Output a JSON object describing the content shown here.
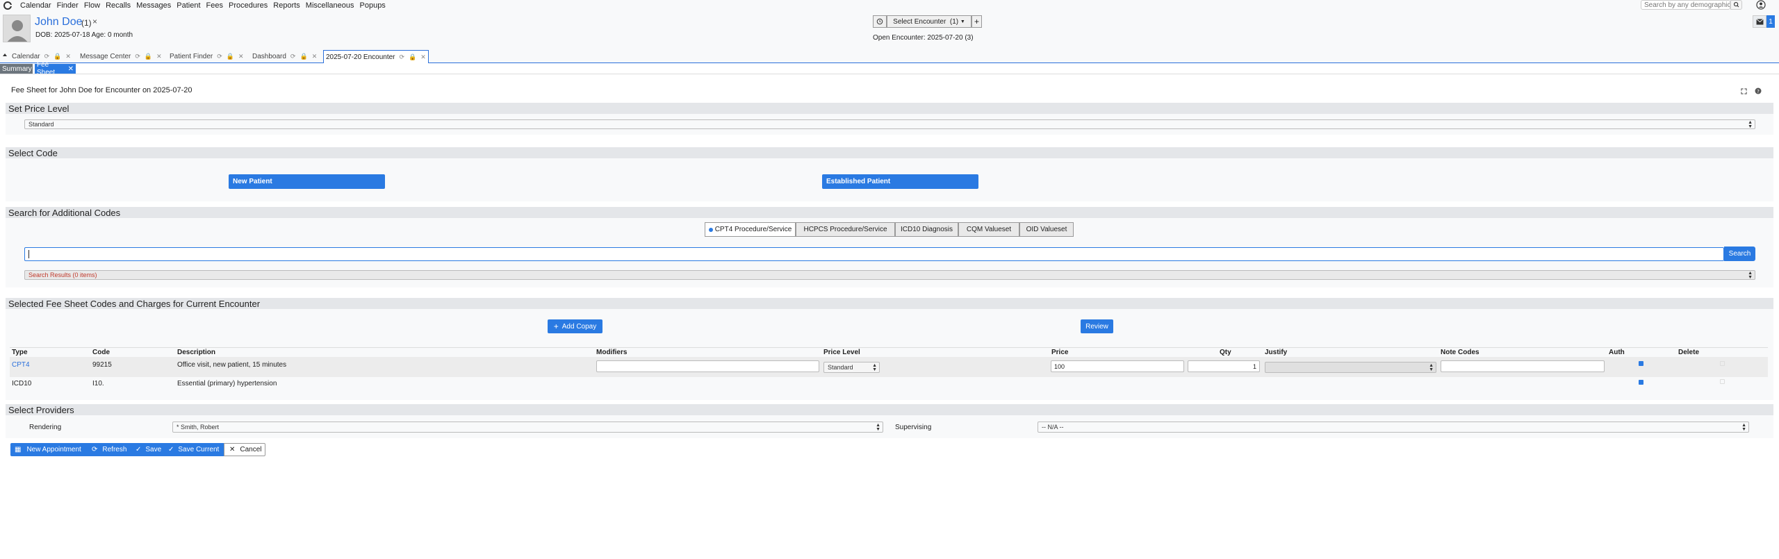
{
  "menu": [
    "Calendar",
    "Finder",
    "Flow",
    "Recalls",
    "Messages",
    "Patient",
    "Fees",
    "Procedures",
    "Reports",
    "Miscellaneous",
    "Popups"
  ],
  "search": {
    "placeholder": "Search by any demographics"
  },
  "patient": {
    "name": "John Doe",
    "count": "(1)",
    "close": "×",
    "dob": "DOB: 2025-07-18 Age: 0 month"
  },
  "encounter": {
    "history_icon": "history-icon",
    "select_label": "Select Encounter",
    "select_count": "(1)",
    "add": "+",
    "open_label": "Open Encounter: 2025-07-20 (3)"
  },
  "notifications": {
    "count": "1"
  },
  "tabs": [
    {
      "label": "Calendar"
    },
    {
      "label": "Message Center"
    },
    {
      "label": "Patient Finder"
    },
    {
      "label": "Dashboard"
    },
    {
      "label": "2025-07-20 Encounter"
    }
  ],
  "subtabs": {
    "summary": "Summary",
    "feesheet": "Fee Sheet"
  },
  "page": {
    "title": "Fee Sheet for John Doe for Encounter on 2025-07-20"
  },
  "price_level": {
    "header": "Set Price Level",
    "value": "Standard"
  },
  "select_code": {
    "header": "Select Code",
    "new_patient": "New Patient",
    "established_patient": "Established Patient"
  },
  "additional": {
    "header": "Search for Additional Codes",
    "code_types": [
      "CPT4 Procedure/Service",
      "HCPCS Procedure/Service",
      "ICD10 Diagnosis",
      "CQM Valueset",
      "OID Valueset"
    ],
    "search_value": "",
    "search_button": "Search",
    "results": "Search Results (0 items)"
  },
  "selected": {
    "header": "Selected Fee Sheet Codes and Charges for Current Encounter",
    "add_copay": "Add Copay",
    "review": "Review",
    "columns": [
      "Type",
      "Code",
      "Description",
      "Modifiers",
      "Price Level",
      "Price",
      "Qty",
      "Justify",
      "Note Codes",
      "Auth",
      "Delete"
    ],
    "rows": [
      {
        "type": "CPT4",
        "code": "99215",
        "description": "Office visit, new patient, 15 minutes",
        "modifiers": "",
        "price_level": "Standard",
        "price": "100",
        "qty": "1",
        "justify": "",
        "note_codes": ""
      },
      {
        "type": "ICD10",
        "code": "I10.",
        "description": "Essential (primary) hypertension"
      }
    ]
  },
  "providers": {
    "header": "Select Providers",
    "rendering_label": "Rendering",
    "rendering_value": "* Smith, Robert",
    "supervising_label": "Supervising",
    "supervising_value": "-- N/A --"
  },
  "actions": {
    "new_appointment": "New Appointment",
    "refresh": "Refresh",
    "save": "Save",
    "save_current": "Save Current",
    "cancel": "Cancel"
  },
  "colors": {
    "accent": "#2a7ae2",
    "link": "#2a6fdb",
    "error": "#c0392b",
    "header_bg": "#e4e6e9"
  }
}
